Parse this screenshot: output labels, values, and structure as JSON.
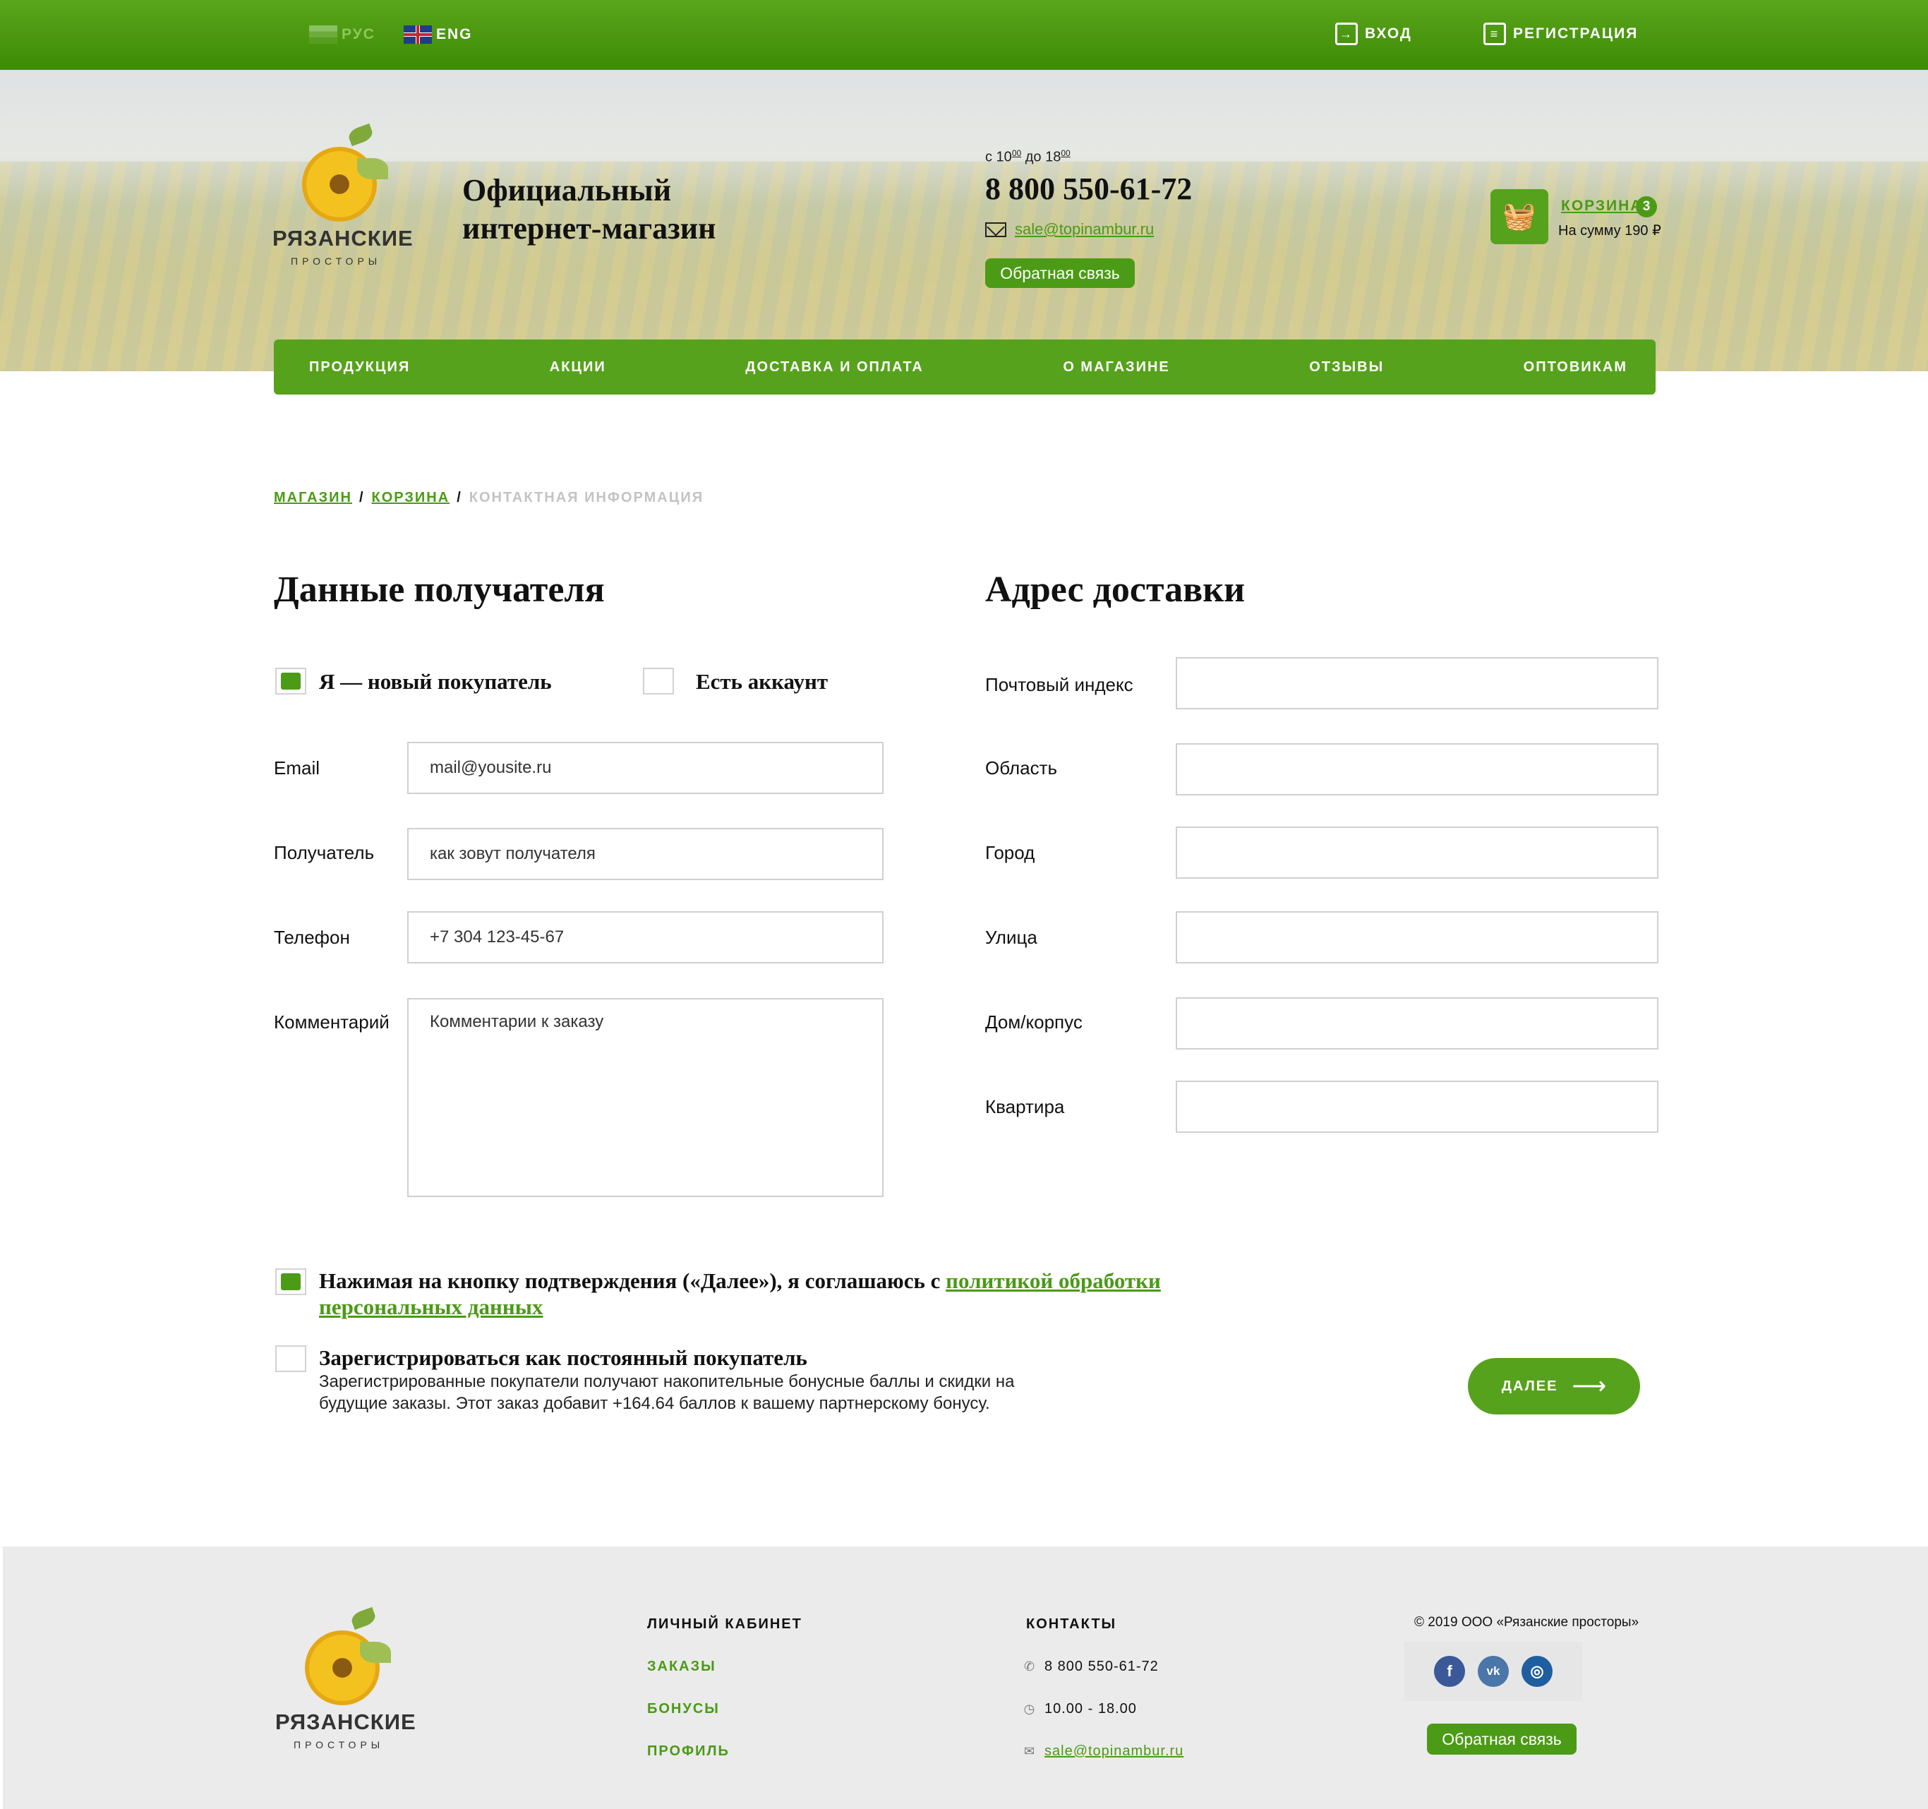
{
  "topbar": {
    "lang_ru": "РУС",
    "lang_en": "ENG",
    "login": "ВХОД",
    "register": "РЕГИСТРАЦИЯ"
  },
  "header": {
    "logo_name": "РЯЗАНСКИЕ",
    "logo_sub": "ПРОСТОРЫ",
    "title": "Официальный интернет-магазин",
    "hours_prefix": "с 10",
    "hours_from_min": "00",
    "hours_mid": " до 18",
    "hours_to_min": "00",
    "phone": "8 800 550-61-72",
    "email": "sale@topinambur.ru",
    "feedback": "Обратная связь",
    "cart_label": "КОРЗИНА",
    "cart_count": "3",
    "cart_sum": "На сумму 190 ₽"
  },
  "nav": [
    "ПРОДУКЦИЯ",
    "АКЦИИ",
    "ДОСТАВКА И ОПЛАТА",
    "О МАГАЗИНЕ",
    "ОТЗЫВЫ",
    "ОПТОВИКАМ"
  ],
  "breadcrumb": {
    "shop": "МАГАЗИН",
    "cart": "КОРЗИНА",
    "current": "КОНТАКТНАЯ ИНФОРМАЦИЯ",
    "sep": "/"
  },
  "recipient": {
    "title": "Данные получателя",
    "new_buyer": "Я — новый покупатель",
    "new_buyer_checked": true,
    "has_account": "Есть аккаунт",
    "has_account_checked": false,
    "email_label": "Email",
    "email_placeholder": "mail@yousite.ru",
    "name_label": "Получатель",
    "name_placeholder": "как зовут получателя",
    "phone_label": "Телефон",
    "phone_placeholder": "+7 304 123-45-67",
    "comment_label": "Комментарий",
    "comment_placeholder": "Комментарии к заказу"
  },
  "delivery": {
    "title": "Адрес доставки",
    "zip_label": "Почтовый индекс",
    "region_label": "Область",
    "city_label": "Город",
    "street_label": "Улица",
    "house_label": "Дом/корпус",
    "flat_label": "Квартира"
  },
  "agreement": {
    "checked": true,
    "text": "Нажимая на кнопку подтверждения («Далее»), я соглашаюсь с ",
    "link": "политикой обработки персональных данных"
  },
  "register_regular": {
    "checked": false,
    "title": "Зарегистрироваться как постоянный покупатель",
    "desc": "Зарегистрированные покупатели получают накопительные бонусные баллы и скидки на будущие заказы. Этот заказ добавит +164.64 баллов к вашему партнерскому бонусу."
  },
  "next_button": "ДАЛЕЕ",
  "footer": {
    "logo_name": "РЯЗАНСКИЕ",
    "logo_sub": "ПРОСТОРЫ",
    "account_title": "ЛИЧНЫЙ КАБИНЕТ",
    "account_links": [
      "ЗАКАЗЫ",
      "БОНУСЫ",
      "ПРОФИЛЬ"
    ],
    "contacts_title": "КОНТАКТЫ",
    "phone": "8 800 550-61-72",
    "hours": "10.00 - 18.00",
    "email": "sale@topinambur.ru",
    "copyright": "© 2019 ООО «Рязанские просторы»",
    "feedback": "Обратная связь",
    "social": [
      "f",
      "vk",
      "ig"
    ]
  },
  "colors": {
    "brand_green": "#56a21c",
    "link_green": "#4a9a16",
    "footer_bg": "#ebebeb"
  }
}
